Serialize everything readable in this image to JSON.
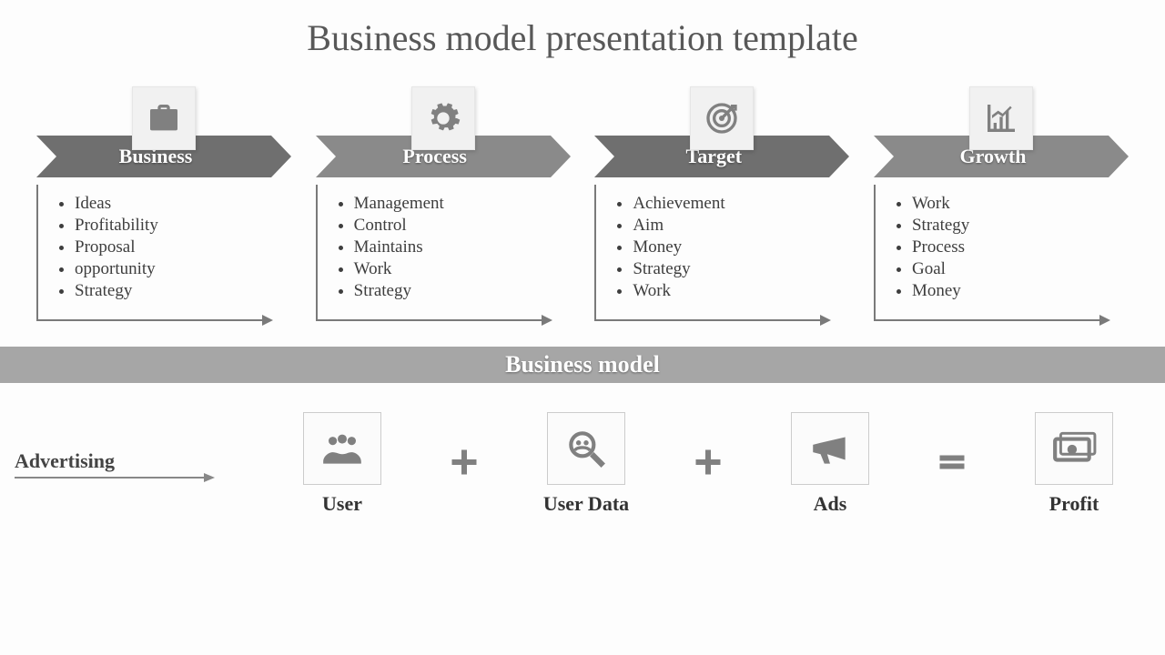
{
  "title": "Business model presentation template",
  "columns": [
    {
      "icon": "briefcase",
      "label": "Business",
      "items": [
        "Ideas",
        "Profitability",
        "Proposal",
        "opportunity",
        "Strategy"
      ]
    },
    {
      "icon": "gear",
      "label": "Process",
      "items": [
        "Management",
        "Control",
        "Maintains",
        "Work",
        "Strategy"
      ]
    },
    {
      "icon": "target",
      "label": "Target",
      "items": [
        "Achievement",
        "Aim",
        "Money",
        "Strategy",
        "Work"
      ]
    },
    {
      "icon": "chart",
      "label": "Growth",
      "items": [
        "Work",
        "Strategy",
        "Process",
        "Goal",
        "Money"
      ]
    }
  ],
  "section_label": "Business model",
  "advertising_label": "Advertising",
  "model": [
    {
      "icon": "users",
      "caption": "User"
    },
    {
      "op": "plus"
    },
    {
      "icon": "userdata",
      "caption": "User Data"
    },
    {
      "op": "plus"
    },
    {
      "icon": "megaphone",
      "caption": "Ads"
    },
    {
      "op": "equals"
    },
    {
      "icon": "money",
      "caption": "Profit"
    }
  ]
}
